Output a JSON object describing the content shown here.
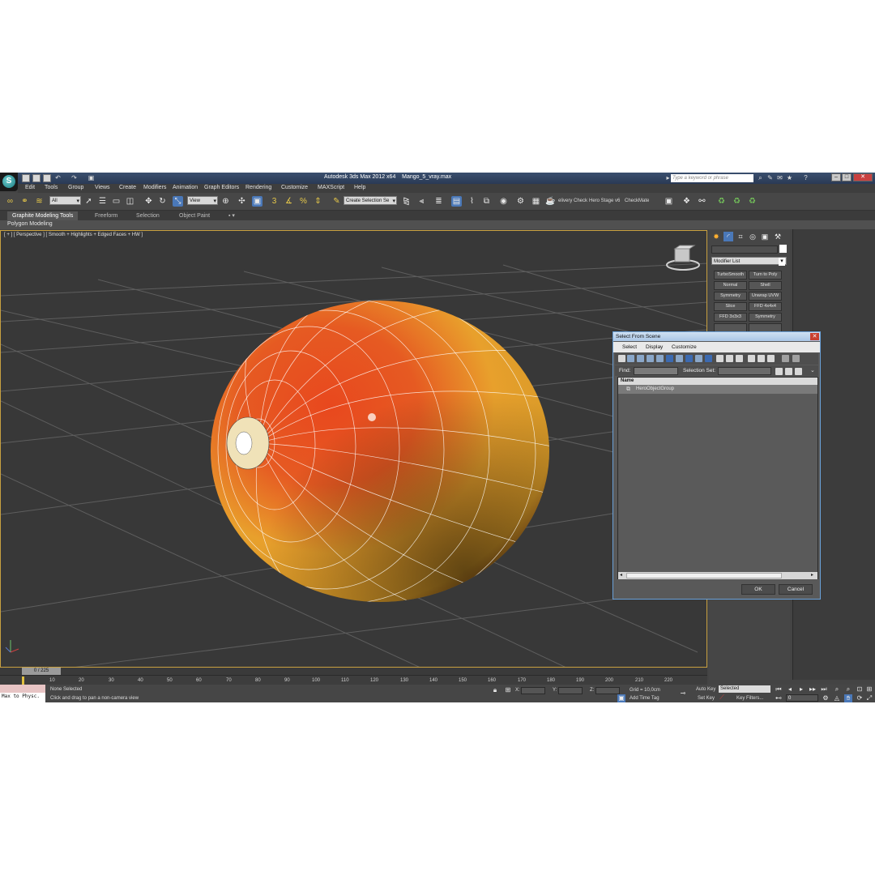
{
  "title": {
    "app": "Autodesk 3ds Max  2012 x64",
    "file": "Mango_5_vray.max",
    "search_placeholder": "Type a keyword or phrase"
  },
  "menu": [
    "Edit",
    "Tools",
    "Group",
    "Views",
    "Create",
    "Modifiers",
    "Animation",
    "Graph Editors",
    "Rendering",
    "Customize",
    "MAXScript",
    "Help"
  ],
  "toolbar": {
    "selection_filter": "All",
    "ref_coord": "View",
    "selection_set": "Create Selection Se",
    "plugin1": "elivery Check",
    "plugin2": "Hero Stage v6",
    "plugin3": "CheckMate"
  },
  "ribbon": {
    "tabs": [
      "Graphite Modeling Tools",
      "Freeform",
      "Selection",
      "Object Paint"
    ],
    "sub": "Polygon Modeling"
  },
  "viewport": {
    "label": "[ + ] [ Perspective ] [ Smooth + Highlights + Edged Faces + HW ]"
  },
  "command_panel": {
    "modifier_list": "Modifier List",
    "buttons": [
      "TurboSmooth",
      "Turn to Poly",
      "Normal",
      "Shell",
      "Symmetry",
      "Unwrap UVW",
      "Slice",
      "FFD 4x4x4",
      "FFD 3x3x3",
      "Symmetry"
    ]
  },
  "dialog": {
    "title": "Select From Scene",
    "menu": [
      "Select",
      "Display",
      "Customize"
    ],
    "find_label": "Find:",
    "selection_set_label": "Selection Set:",
    "column_name": "Name",
    "item": "HeroObjectGroup",
    "ok": "OK",
    "cancel": "Cancel"
  },
  "timeline": {
    "position": "0 / 225",
    "ticks": [
      "10",
      "20",
      "30",
      "40",
      "50",
      "60",
      "70",
      "80",
      "90",
      "100",
      "110",
      "120",
      "130",
      "140",
      "150",
      "160",
      "170",
      "180",
      "190",
      "200",
      "210",
      "220"
    ]
  },
  "status": {
    "maxscript": "Max to Physc.",
    "selection": "None Selected",
    "prompt": "Click and drag to pan a non-camera view",
    "x_label": "X:",
    "y_label": "Y:",
    "z_label": "Z:",
    "grid": "Grid = 10,0cm",
    "add_time_tag": "Add Time Tag",
    "auto_key": "Auto Key",
    "set_key": "Set Key",
    "key_mode": "Selected",
    "key_filters": "Key Filters...",
    "frame": "0"
  },
  "colors": {
    "viewport_border": "#c8a040",
    "dialog_title": "#a9c6e6",
    "mango_red": "#d84a20",
    "mango_yellow": "#e8b030",
    "grid_line": "#5a5a5a"
  }
}
